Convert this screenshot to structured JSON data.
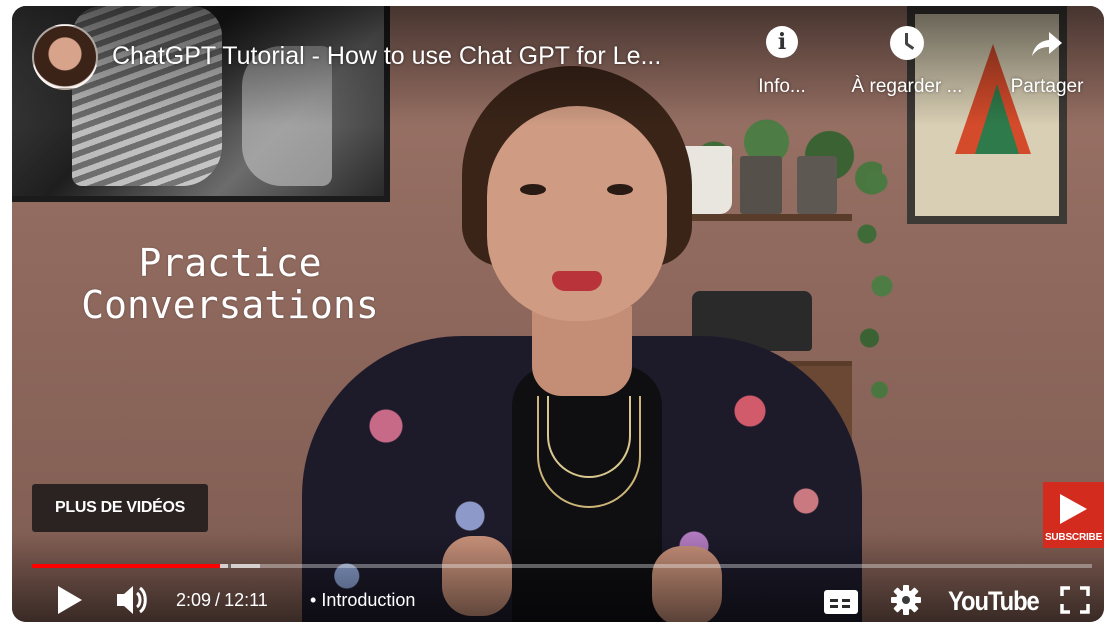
{
  "header": {
    "title": "ChatGPT Tutorial - How to use Chat GPT for Le...",
    "info_label": "Info...",
    "watch_later_label": "À regarder ...",
    "share_label": "Partager"
  },
  "overlay": {
    "line1": "Practice",
    "line2": "Conversations"
  },
  "more_videos_label": "PLUS DE VIDÉOS",
  "subscribe_label": "SUBSCRIBE",
  "controls": {
    "current_time": "2:09",
    "time_separator": "/",
    "duration": "12:11",
    "chapter_bullet": "•",
    "chapter": "Introduction",
    "logo_text": "YouTube"
  },
  "progress": {
    "played_fraction": 0.177,
    "buffered_fraction": 0.215
  },
  "colors": {
    "progress_played": "#ff0000",
    "subscribe_bg": "#d42b1f"
  },
  "icons": [
    "info-icon",
    "clock-icon",
    "share-icon",
    "play-icon",
    "volume-icon",
    "subtitles-icon",
    "gear-icon",
    "fullscreen-icon"
  ]
}
